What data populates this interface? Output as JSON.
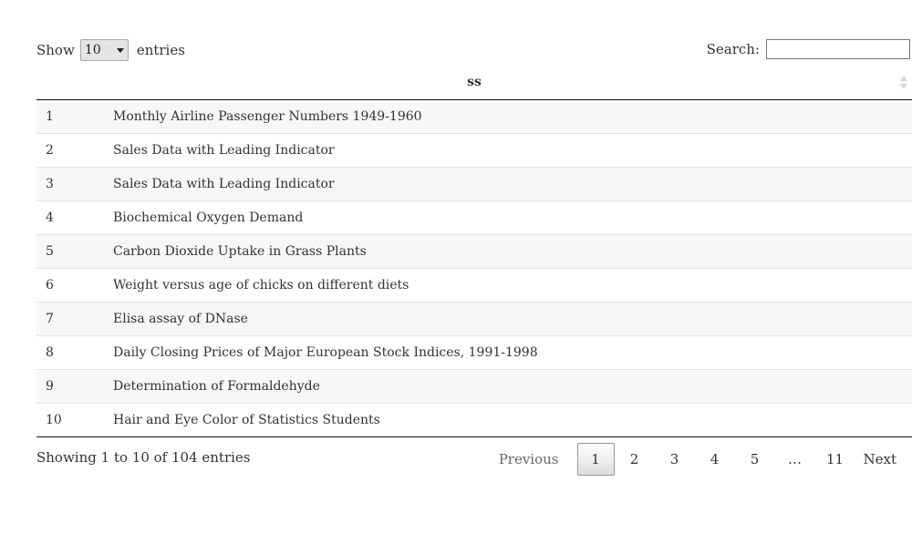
{
  "length": {
    "show_label": "Show",
    "selected": "10",
    "entries_label": "entries"
  },
  "search": {
    "label": "Search:",
    "value": ""
  },
  "table": {
    "column_header": "ss",
    "rows": [
      {
        "index": "1",
        "title": "Monthly Airline Passenger Numbers 1949-1960"
      },
      {
        "index": "2",
        "title": "Sales Data with Leading Indicator"
      },
      {
        "index": "3",
        "title": "Sales Data with Leading Indicator"
      },
      {
        "index": "4",
        "title": "Biochemical Oxygen Demand"
      },
      {
        "index": "5",
        "title": "Carbon Dioxide Uptake in Grass Plants"
      },
      {
        "index": "6",
        "title": "Weight versus age of chicks on different diets"
      },
      {
        "index": "7",
        "title": "Elisa assay of DNase"
      },
      {
        "index": "8",
        "title": "Daily Closing Prices of Major European Stock Indices, 1991-1998"
      },
      {
        "index": "9",
        "title": "Determination of Formaldehyde"
      },
      {
        "index": "10",
        "title": "Hair and Eye Color of Statistics Students"
      }
    ]
  },
  "footer": {
    "info": "Showing 1 to 10 of 104 entries",
    "previous": "Previous",
    "pages": [
      "1",
      "2",
      "3",
      "4",
      "5"
    ],
    "ellipsis": "…",
    "last_page": "11",
    "next": "Next",
    "current_page": "1"
  }
}
